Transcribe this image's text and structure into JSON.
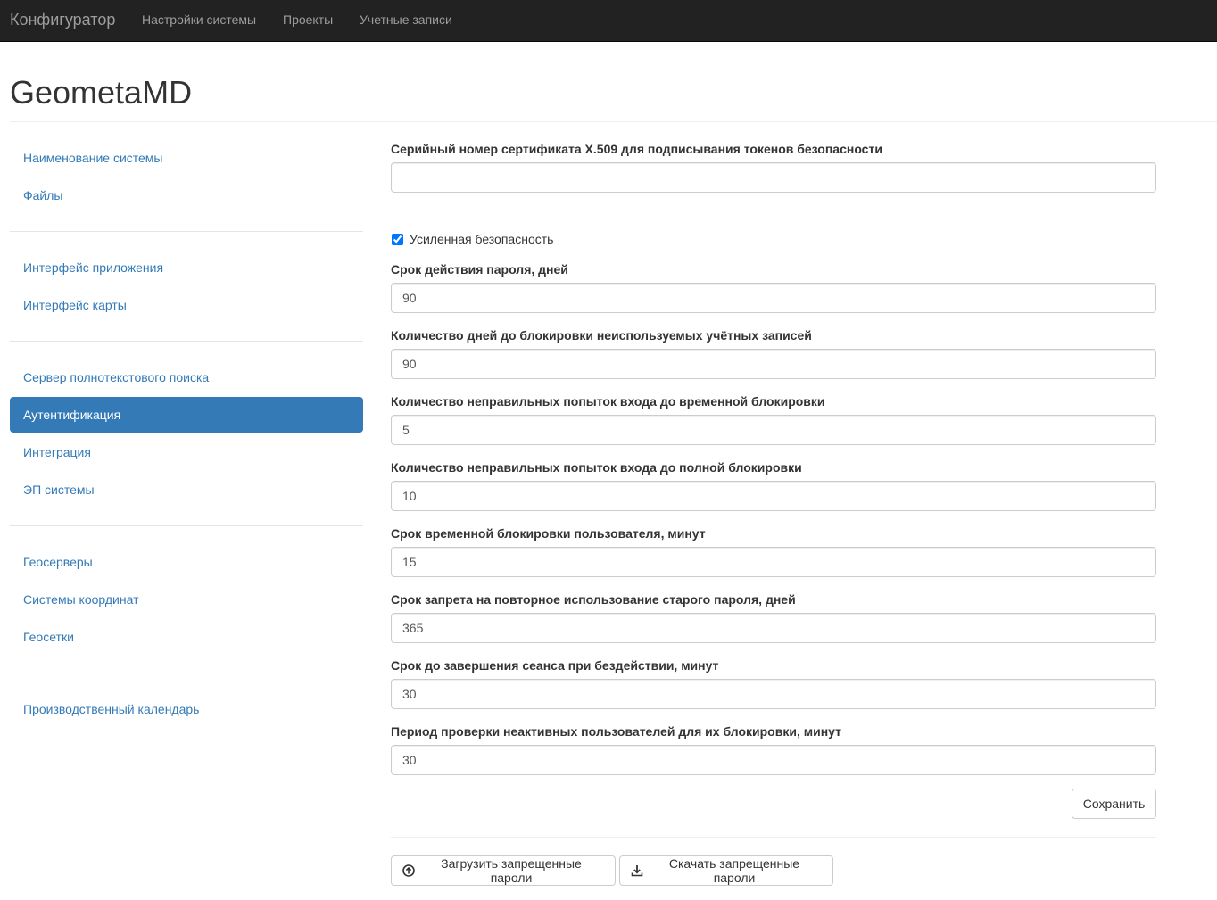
{
  "navbar": {
    "brand": "Конфигуратор",
    "links": [
      "Настройки системы",
      "Проекты",
      "Учетные записи"
    ]
  },
  "page": {
    "title": "GeometaMD"
  },
  "sidebar": {
    "items": [
      "Наименование системы",
      "Файлы",
      "Интерфейс приложения",
      "Интерфейс карты",
      "Сервер полнотекстового поиска",
      "Аутентификация",
      "Интеграция",
      "ЭП системы",
      "Геосерверы",
      "Системы координат",
      "Геосетки",
      "Производственный календарь"
    ],
    "active": "Аутентификация"
  },
  "form": {
    "cert_label": "Серийный номер сертификата X.509 для подписывания токенов безопасности",
    "cert_value": "",
    "enhanced_security_label": "Усиленная безопасность",
    "enhanced_security_checked": true,
    "fields": [
      {
        "label": "Срок действия пароля, дней",
        "value": "90"
      },
      {
        "label": "Количество дней до блокировки неиспользуемых учётных записей",
        "value": "90"
      },
      {
        "label": "Количество неправильных попыток входа до временной блокировки",
        "value": "5"
      },
      {
        "label": "Количество неправильных попыток входа до полной блокировки",
        "value": "10"
      },
      {
        "label": "Срок временной блокировки пользователя, минут",
        "value": "15"
      },
      {
        "label": "Срок запрета на повторное использование старого пароля, дней",
        "value": "365"
      },
      {
        "label": "Срок до завершения сеанса при бездействии, минут",
        "value": "30"
      },
      {
        "label": "Период проверки неактивных пользователей для их блокировки, минут",
        "value": "30"
      }
    ],
    "save_label": "Сохранить",
    "upload_label": "Загрузить запрещенные пароли",
    "download_label": "Скачать запрещенные пароли"
  },
  "icons": {
    "upload": "circle-arrow-up-icon",
    "download": "download-icon"
  },
  "colors": {
    "navbar_bg": "#222222",
    "accent": "#337ab7",
    "link": "#337ab7"
  }
}
